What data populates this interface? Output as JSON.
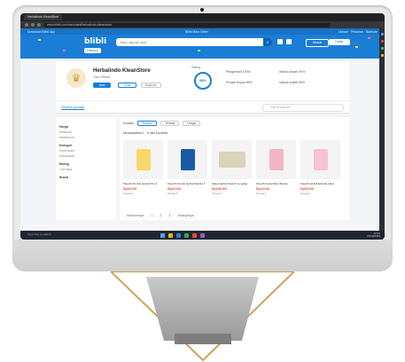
{
  "browser": {
    "tab_title": "Herbalindo KleanStore",
    "url": "www.blibli.com/merchant/herbalindo-kleanstore"
  },
  "header": {
    "top_left": "Download Blibli App",
    "top_mid": "Blibli Mitra Seller",
    "top_right": "Ulasan · Pesanan · Bantuan",
    "brand": "blibli",
    "category_label": "Kategori",
    "search_placeholder": "Kamu lagi cari apa?",
    "login_label": "Masuk",
    "register_label": "Daftar",
    "address_label": "Tentukan alamat"
  },
  "store": {
    "name": "Herbalindo KleanStore",
    "subtitle": "Toko Official",
    "follow_label": "Ikuti",
    "chat_label": "Chat",
    "share_label": "Bagikan",
    "rating_label": "Rating",
    "rating_value": "98%",
    "stats": [
      "Pengiriman 100%",
      "Produk terjual 98%",
      "Waktu proses 90%",
      "Ulasan positif 99%"
    ]
  },
  "tabs": {
    "home_label": "Semua produk",
    "store_search_placeholder": "Cari di toko ini"
  },
  "filters": {
    "heading_price": "Harga",
    "price_min": "Minimum",
    "price_max": "Maksimum",
    "heading_category": "Kategori",
    "cat1": "Kesehatan",
    "cat2": "Kecantikan",
    "heading_rating": "Rating",
    "rating_item": "4 ke atas",
    "heading_brand": "Brand"
  },
  "sort": {
    "label": "Urutkan",
    "chips": [
      "Terbaru",
      "Terlaris",
      "Harga"
    ]
  },
  "results_text": "Menampilkan 1 - 5 dari 5 produk",
  "products": [
    {
      "name": "KleanS Produk Herbal Pria 1",
      "price": "Rp59.000",
      "meta": "Terjual 1",
      "color": "#f8d86b"
    },
    {
      "name": "KleanS Produk Herbal Wanita 2",
      "price": "Rp64.000",
      "meta": "Terjual 3",
      "color": "#1b5aa6"
    },
    {
      "name": "Paket Herbal KleanS Lengkap",
      "price": "Rp188.000",
      "meta": "Terjual 2",
      "color": "#d9d3b8"
    },
    {
      "name": "KleanS Kecantikan Wanita",
      "price": "Rp49.000",
      "meta": "Terjual 1",
      "color": "#f2b5c4"
    },
    {
      "name": "KleanS Herbal Ekstrak Alami",
      "price": "Rp55.000",
      "meta": "Terjual 4",
      "color": "#f7c3d0"
    }
  ],
  "pager": [
    "Sebelumnya",
    "1",
    "2",
    "3",
    "Selanjutnya"
  ],
  "taskbar": {
    "search": "Type here to search",
    "time": "12:40",
    "date": "20/10/2023"
  }
}
